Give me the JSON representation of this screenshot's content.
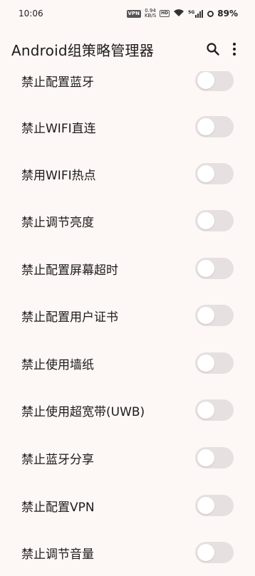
{
  "status": {
    "time": "10:06",
    "vpn": "VPN",
    "net_speed_value": "0.94",
    "net_speed_unit": "KB/S",
    "hd": "HD",
    "signal": "5G",
    "battery": "89%"
  },
  "app_bar": {
    "title": "Android组策略管理器",
    "search_icon": "search-icon",
    "more_icon": "more-vert-icon"
  },
  "settings": [
    {
      "label": "禁止配置蓝牙",
      "enabled": false
    },
    {
      "label": "禁止WIFI直连",
      "enabled": false
    },
    {
      "label": "禁用WIFI热点",
      "enabled": false
    },
    {
      "label": "禁止调节亮度",
      "enabled": false
    },
    {
      "label": "禁止配置屏幕超时",
      "enabled": false
    },
    {
      "label": "禁止配置用户证书",
      "enabled": false
    },
    {
      "label": "禁止使用墙纸",
      "enabled": false
    },
    {
      "label": "禁止使用超宽带(UWB)",
      "enabled": false
    },
    {
      "label": "禁止蓝牙分享",
      "enabled": false
    },
    {
      "label": "禁止配置VPN",
      "enabled": false
    },
    {
      "label": "禁止调节音量",
      "enabled": false
    }
  ],
  "colors": {
    "background": "#fdf7f5",
    "switch_track_off": "#e6e1e0",
    "switch_thumb": "#ffffff"
  }
}
